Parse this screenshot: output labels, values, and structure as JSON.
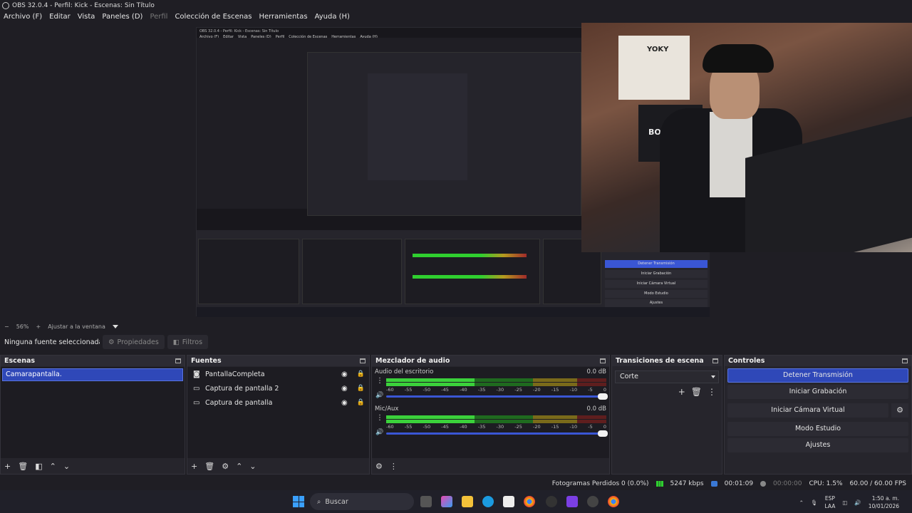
{
  "window": {
    "title": "OBS 32.0.4 - Perfil: Kick - Escenas: Sin Título"
  },
  "menu": [
    {
      "label": "Archivo (F)",
      "enabled": true
    },
    {
      "label": "Editar",
      "enabled": true
    },
    {
      "label": "Vista",
      "enabled": true
    },
    {
      "label": "Paneles (D)",
      "enabled": true
    },
    {
      "label": "Perfil",
      "enabled": false
    },
    {
      "label": "Colección de Escenas",
      "enabled": true
    },
    {
      "label": "Herramientas",
      "enabled": true
    },
    {
      "label": "Ayuda (H)",
      "enabled": true
    }
  ],
  "preview": {
    "nested_title": "OBS 32.0.4 - Perfil: Kick - Escenas: Sin Título",
    "nested_menu": [
      "Archivo (F)",
      "Editar",
      "Vista",
      "Paneles (D)",
      "Perfil",
      "Colección de Escenas",
      "Herramientas",
      "Ayuda (H)"
    ],
    "nested_controls": [
      "Detener Transmisión",
      "Iniciar Grabación",
      "Iniciar Cámara Virtual",
      "Modo Estudio",
      "Ajustes"
    ],
    "cam_text": [
      "YOKY",
      "BOGOTA"
    ]
  },
  "zoom": {
    "minus": "−",
    "value": "56%",
    "plus": "+",
    "fit": "Ajustar a la ventana"
  },
  "context": {
    "no_selection": "Ninguna fuente seleccionada",
    "properties": "Propiedades",
    "filters": "Filtros"
  },
  "scenes": {
    "title": "Escenas",
    "items": [
      "Camarapantalla."
    ]
  },
  "sources": {
    "title": "Fuentes",
    "items": [
      {
        "name": "PantallaCompleta",
        "icon": "camera-icon"
      },
      {
        "name": "Captura de pantalla 2",
        "icon": "monitor-icon"
      },
      {
        "name": "Captura de pantalla",
        "icon": "monitor-icon"
      }
    ]
  },
  "mixer": {
    "title": "Mezclador de audio",
    "scale": [
      "-60",
      "-55",
      "-50",
      "-45",
      "-40",
      "-35",
      "-30",
      "-25",
      "-20",
      "-15",
      "-10",
      "-5",
      "0"
    ],
    "channels": [
      {
        "name": "Audio del escritorio",
        "db": "0.0 dB",
        "level": 0.62,
        "peak": 0.79
      },
      {
        "name": "Mic/Aux",
        "db": "0.0 dB",
        "level": 0.6,
        "peak": 0.85
      }
    ]
  },
  "transitions": {
    "title": "Transiciones de escena",
    "selected": "Corte"
  },
  "controls": {
    "title": "Controles",
    "stop_stream": "Detener Transmisión",
    "start_record": "Iniciar Grabación",
    "start_virtualcam": "Iniciar Cámara Virtual",
    "studio_mode": "Modo Estudio",
    "settings": "Ajustes"
  },
  "status": {
    "dropped": "Fotogramas Perdidos 0 (0.0%)",
    "bitrate": "5247 kbps",
    "live_time": "00:01:09",
    "rec_time": "00:00:00",
    "cpu": "CPU: 1.5%",
    "fps": "60.00 / 60.00 FPS"
  },
  "taskbar": {
    "search": "Buscar",
    "lang_top": "ESP",
    "lang_bottom": "LAA",
    "time": "1:50 a. m.",
    "date": "10/01/2026"
  },
  "colors": {
    "accent": "#2f48b8",
    "panel": "#26252c",
    "background": "#1f1e24"
  }
}
